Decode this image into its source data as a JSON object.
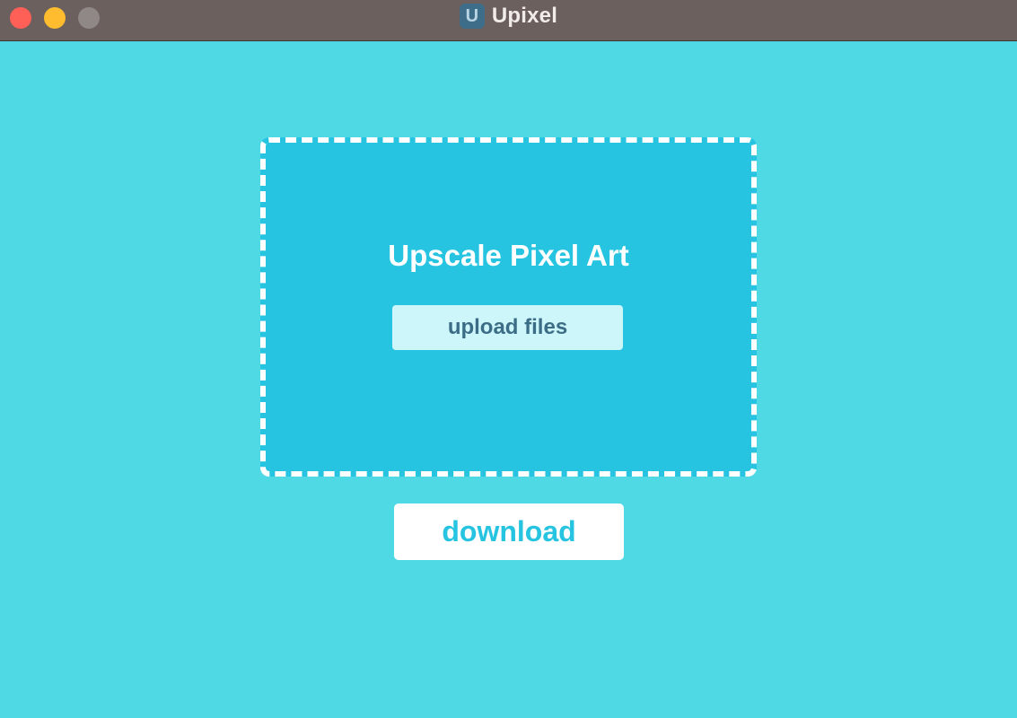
{
  "window": {
    "title": "Upixel",
    "app_icon_letter": "U"
  },
  "dropzone": {
    "headline": "Upscale Pixel Art",
    "upload_label": "upload files"
  },
  "actions": {
    "download_label": "download"
  },
  "colors": {
    "background": "#4fd9e5",
    "dropzone": "#27c4e1",
    "titlebar": "#6b605d",
    "upload_button": "#cdf6fb",
    "download_text": "#27c4e1"
  }
}
